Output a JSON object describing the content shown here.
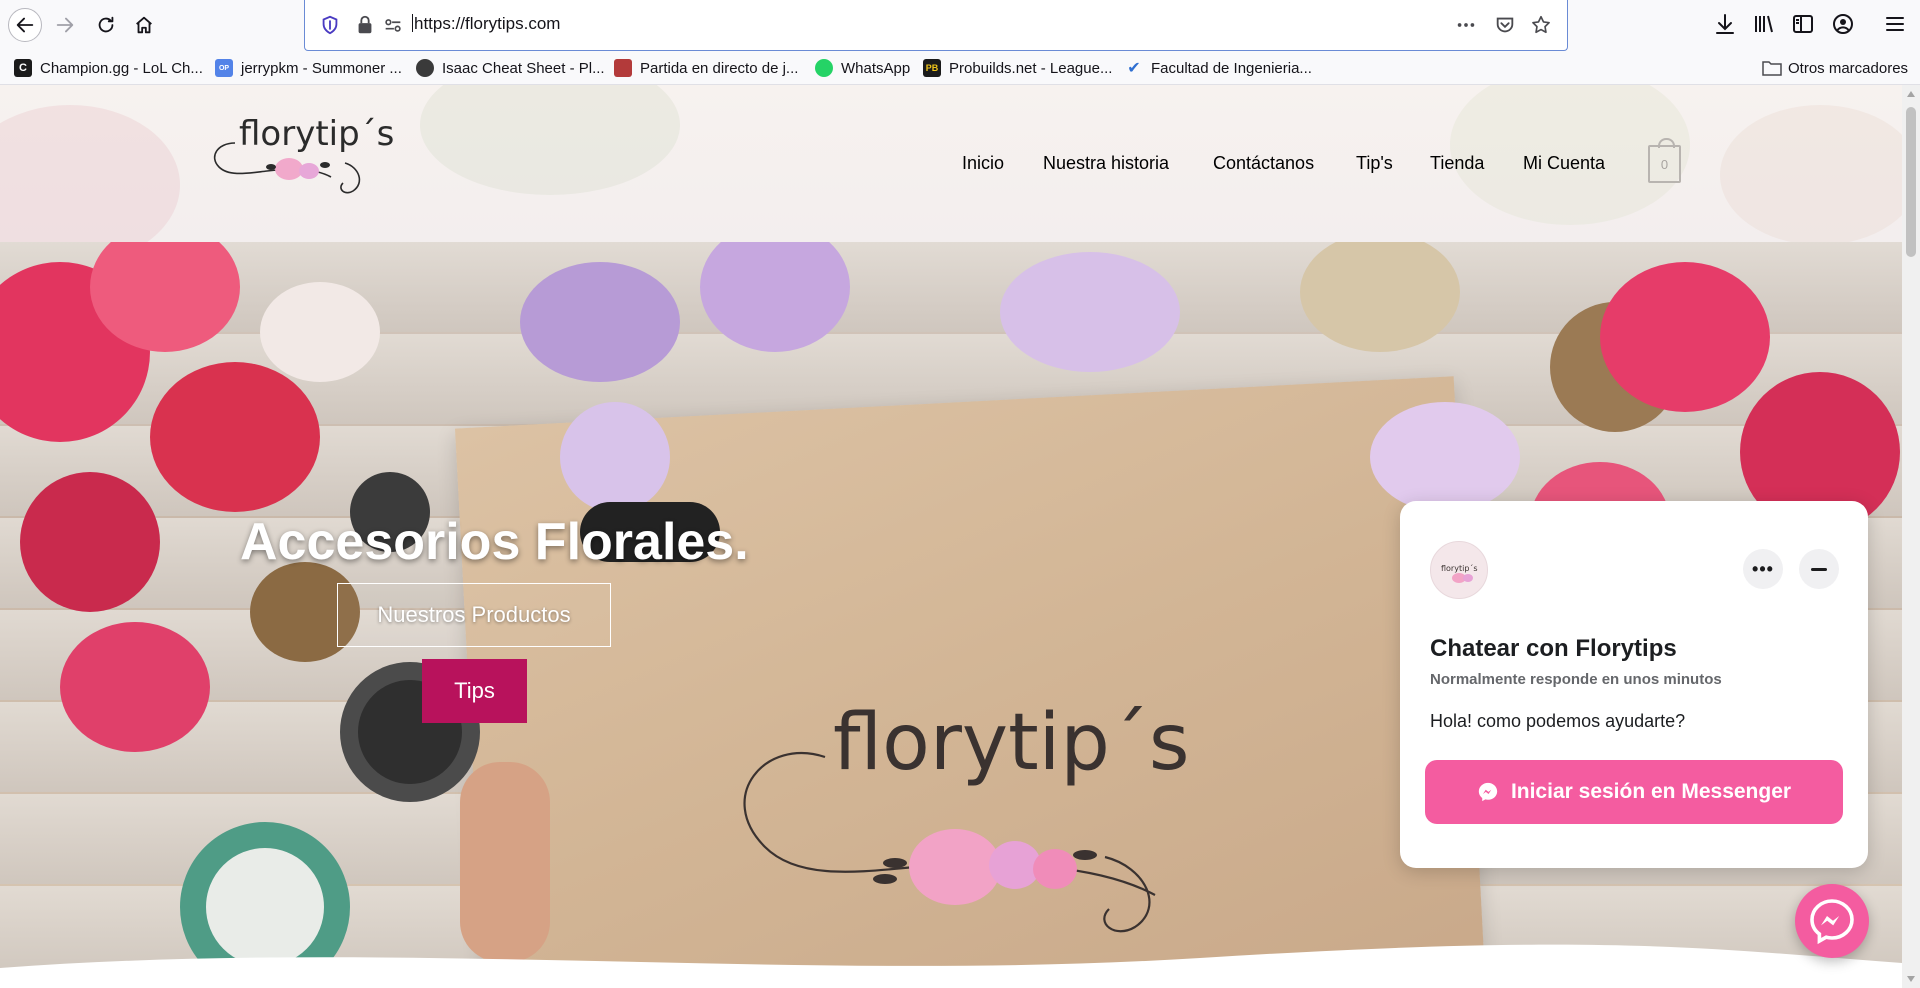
{
  "browser": {
    "url": "https://florytips.com",
    "bookmarks": [
      {
        "label": "Champion.gg - LoL Ch...",
        "icon": "champion-gg-icon"
      },
      {
        "label": "jerrypkm - Summoner ...",
        "icon": "opgg-icon"
      },
      {
        "label": "Isaac Cheat Sheet - Pl...",
        "icon": "isaac-icon"
      },
      {
        "label": "Partida en directo de j...",
        "icon": "partida-icon"
      },
      {
        "label": "WhatsApp",
        "icon": "whatsapp-icon"
      },
      {
        "label": "Probuilds.net - League...",
        "icon": "probuilds-icon"
      },
      {
        "label": "Facultad de Ingenieria...",
        "icon": "facultad-icon"
      }
    ],
    "other_bookmarks": "Otros marcadores"
  },
  "site": {
    "logo_text": "florytip´s",
    "nav": [
      "Inicio",
      "Nuestra historia",
      "Contáctanos",
      "Tip's",
      "Tienda",
      "Mi Cuenta"
    ],
    "cart_count": "0",
    "accent_color": "#b8125c"
  },
  "hero": {
    "title": "Accesorios Florales.",
    "btn_products": "Nuestros Productos",
    "btn_tips": "Tips",
    "center_logo": "florytip´s"
  },
  "chat": {
    "title": "Chatear con Florytips",
    "subtitle": "Normalmente responde en unos minutos",
    "message": "Hola! como podemos ayudarte?",
    "button": "Iniciar sesión en Messenger",
    "avatar_text": "florytip´s",
    "color": "#f45ca0"
  }
}
